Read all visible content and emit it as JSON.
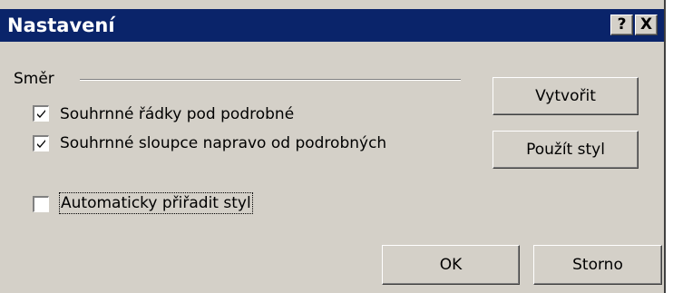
{
  "dialog": {
    "title": "Nastavení",
    "help_label": "?",
    "close_label": "X"
  },
  "group": {
    "label": "Směr"
  },
  "options": {
    "rows_below": {
      "label": "Souhrnné řádky pod podrobné",
      "checked": true
    },
    "cols_right": {
      "label": "Souhrnné sloupce napravo od podrobných",
      "checked": true
    },
    "auto_style": {
      "label": "Automaticky přiřadit styl",
      "checked": false
    }
  },
  "buttons": {
    "create": "Vytvořit",
    "apply_style": "Použít styl",
    "ok": "OK",
    "cancel": "Storno"
  },
  "colors": {
    "titlebar": "#0a246a",
    "face": "#d4d0c8"
  }
}
